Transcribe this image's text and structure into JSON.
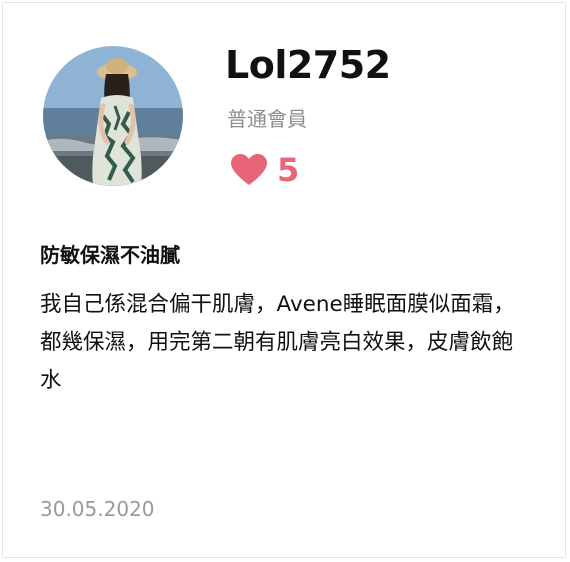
{
  "reviewer": {
    "username": "Lol2752",
    "member_level": "普通會員",
    "likes": "5"
  },
  "review": {
    "title": "防敏保濕不油膩",
    "body": "我自己係混合偏干肌膚，Avene睡眠面膜似面霜，都幾保濕，用完第二朝有肌膚亮白效果，皮膚飲飽水",
    "date": "30.05.2020"
  },
  "colors": {
    "like": "#e86477",
    "muted": "#8e8e8e",
    "text": "#111111"
  },
  "icons": {
    "like": "heart-icon",
    "avatar": "user-photo"
  }
}
